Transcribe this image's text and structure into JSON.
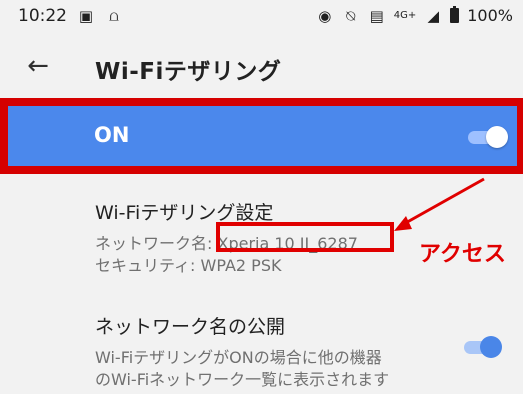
{
  "status_bar": {
    "time": "10:22",
    "left_icons": [
      "image-icon",
      "signal-tool-icon"
    ],
    "right_icons": [
      "location-icon",
      "mute-icon",
      "wifi-icon",
      "network-icon",
      "battery-icon"
    ],
    "network": "4G+",
    "battery": "100%"
  },
  "app_bar": {
    "back_icon": "arrow-left-icon",
    "title": "Wi-Fiテザリング"
  },
  "master_switch": {
    "label": "ON",
    "state": "on",
    "colors": {
      "background": "#4b88ec",
      "highlight_frame": "#d50000"
    }
  },
  "settings": [
    {
      "title": "Wi-Fiテザリング設定",
      "subtitle": "ネットワーク名: Xperia 10 II_6287",
      "subtitle2": "セキュリティ: WPA2 PSK"
    },
    {
      "title": "ネットワーク名の公開",
      "subtitle": "Wi-FiテザリングがONの場合に他の機器",
      "subtitle2": "のWi-Fiネットワーク一覧に表示されます",
      "toggle_state": "on"
    }
  ],
  "annotation": {
    "text": "アクセス",
    "color": "#e00000"
  }
}
